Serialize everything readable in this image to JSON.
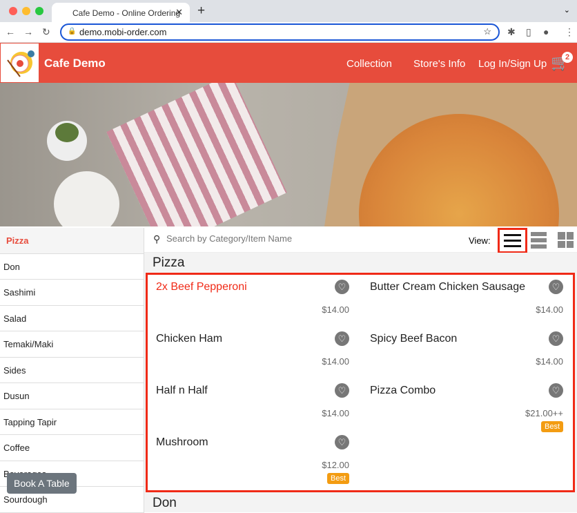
{
  "browser": {
    "tab_title": "Cafe Demo - Online Ordering",
    "url": "demo.mobi-order.com"
  },
  "header": {
    "brand": "Cafe Demo",
    "nav": [
      "Collection",
      "Store's Info",
      "Log In/Sign Up"
    ],
    "cart_count": "2",
    "accent": "#e74c3c"
  },
  "sidebar": {
    "categories": [
      "Pizza",
      "Don",
      "Sashimi",
      "Salad",
      "Temaki/Maki",
      "Sides",
      "Dusun",
      "Tapping Tapir",
      "Coffee",
      "Beverages",
      "Sourdough"
    ],
    "active": "Pizza"
  },
  "search": {
    "placeholder": "Search by Category/Item Name",
    "view_label": "View:"
  },
  "sections": [
    {
      "title": "Pizza",
      "items": [
        {
          "name": "2x Beef Pepperoni",
          "price": "$14.00",
          "highlight": true
        },
        {
          "name": "Butter Cream Chicken Sausage",
          "price": "$14.00"
        },
        {
          "name": "Chicken Ham",
          "price": "$14.00"
        },
        {
          "name": "Spicy Beef Bacon",
          "price": "$14.00"
        },
        {
          "name": "Half n Half",
          "price": "$14.00"
        },
        {
          "name": "Pizza Combo",
          "price": "$21.00++",
          "badge": "Best"
        },
        {
          "name": "Mushroom",
          "price": "$12.00",
          "badge": "Best"
        }
      ]
    },
    {
      "title": "Don"
    }
  ],
  "book_table": "Book A Table"
}
